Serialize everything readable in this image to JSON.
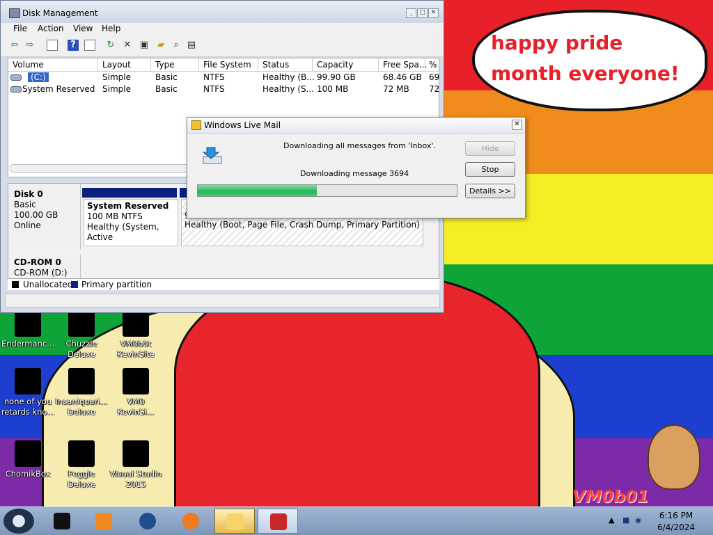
{
  "wallpaper": {
    "speech_bubble": "happy pride month everyone!",
    "watermark": "VM0b01"
  },
  "desktop_icons": [
    {
      "label": "Endermanc...",
      "col": 0,
      "row": 0
    },
    {
      "label": "Chuzzle Deluxe",
      "col": 1,
      "row": 0
    },
    {
      "label": "VM0b0t KevinSite",
      "col": 2,
      "row": 0
    },
    {
      "label": "none of you retards kno...",
      "col": 0,
      "row": 1
    },
    {
      "label": "Insaniquari... Deluxe",
      "col": 1,
      "row": 1
    },
    {
      "label": "VM0 KevinSi...",
      "col": 2,
      "row": 1
    },
    {
      "label": "ChomikBox",
      "col": 0,
      "row": 2
    },
    {
      "label": "Peggle Deluxe",
      "col": 1,
      "row": 2
    },
    {
      "label": "Visual Studio 2015",
      "col": 2,
      "row": 2
    }
  ],
  "disk_mgmt": {
    "title": "Disk Management",
    "menu": [
      "File",
      "Action",
      "View",
      "Help"
    ],
    "columns": [
      "Volume",
      "Layout",
      "Type",
      "File System",
      "Status",
      "Capacity",
      "Free Spa...",
      "%"
    ],
    "volumes": [
      [
        "(C:)",
        "Simple",
        "Basic",
        "NTFS",
        "Healthy (B...",
        "99.90 GB",
        "68.46 GB",
        "69"
      ],
      [
        "System Reserved",
        "Simple",
        "Basic",
        "NTFS",
        "Healthy (S...",
        "100 MB",
        "72 MB",
        "72"
      ]
    ],
    "disk0": {
      "name": "Disk 0",
      "type": "Basic",
      "size": "100.00 GB",
      "state": "Online",
      "part1_name": "System Reserved",
      "part1_size": "100 MB NTFS",
      "part1_status": "Healthy (System, Active",
      "part2_size_partial": "9",
      "part2_status": "Healthy (Boot, Page File, Crash Dump, Primary Partition)"
    },
    "cdrom": {
      "name": "CD-ROM 0",
      "drive": "CD-ROM (D:)"
    },
    "legend": [
      "Unallocated",
      "Primary partition"
    ]
  },
  "mail_dialog": {
    "title": "Windows Live Mail",
    "message_top": "Downloading all messages from 'Inbox'.",
    "message_status": "Downloading message 3694",
    "progress_fraction": 0.46,
    "buttons": {
      "hide": "Hide",
      "stop": "Stop",
      "details": "Details >>"
    }
  },
  "taskbar": {
    "time": "6:16 PM",
    "date": "6/4/2024"
  },
  "colors": {
    "unallocated": "#000000",
    "primary_partition": "#0b1f80",
    "speech_text": "#e8202a"
  }
}
